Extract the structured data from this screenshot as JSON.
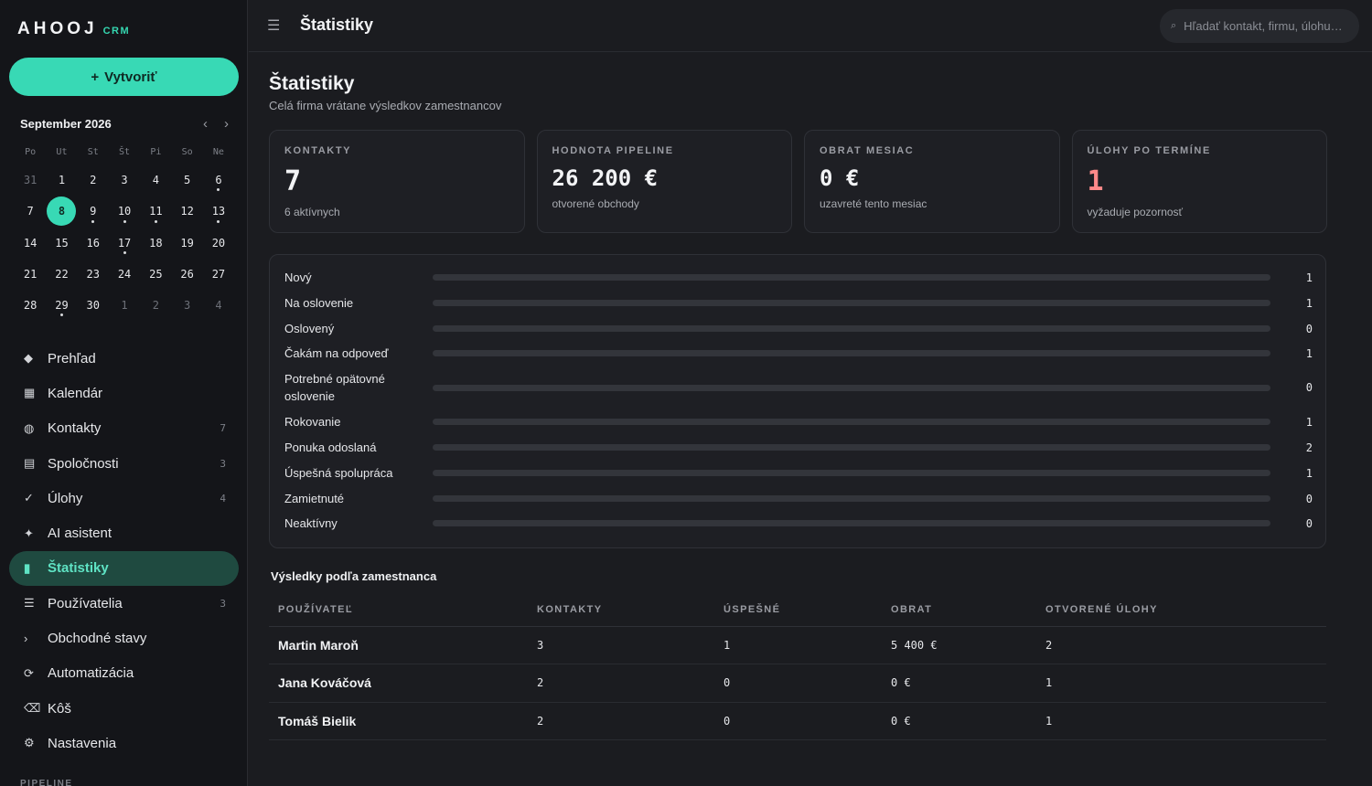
{
  "app": {
    "logo": "AHOOJ",
    "logo_tag": "CRM",
    "create_label": "Vytvoriť",
    "create_icon": "+"
  },
  "calendar": {
    "month_label": "September 2026",
    "prev": "‹",
    "next": "›",
    "weekdays": [
      "Po",
      "Ut",
      "St",
      "Št",
      "Pi",
      "So",
      "Ne"
    ],
    "days": [
      {
        "n": "31",
        "muted": true
      },
      {
        "n": "1"
      },
      {
        "n": "2"
      },
      {
        "n": "3"
      },
      {
        "n": "4"
      },
      {
        "n": "5"
      },
      {
        "n": "6",
        "dot": true
      },
      {
        "n": "7"
      },
      {
        "n": "8",
        "today": true
      },
      {
        "n": "9",
        "dot": true
      },
      {
        "n": "10",
        "dot": true
      },
      {
        "n": "11",
        "dot": true
      },
      {
        "n": "12"
      },
      {
        "n": "13",
        "dot": true
      },
      {
        "n": "14"
      },
      {
        "n": "15"
      },
      {
        "n": "16"
      },
      {
        "n": "17",
        "dot": true
      },
      {
        "n": "18"
      },
      {
        "n": "19"
      },
      {
        "n": "20"
      },
      {
        "n": "21"
      },
      {
        "n": "22"
      },
      {
        "n": "23"
      },
      {
        "n": "24"
      },
      {
        "n": "25"
      },
      {
        "n": "26"
      },
      {
        "n": "27"
      },
      {
        "n": "28"
      },
      {
        "n": "29",
        "dot": true
      },
      {
        "n": "30"
      },
      {
        "n": "1",
        "muted": true
      },
      {
        "n": "2",
        "muted": true
      },
      {
        "n": "3",
        "muted": true
      },
      {
        "n": "4",
        "muted": true
      }
    ]
  },
  "nav": [
    {
      "label": "Prehľad",
      "icon": "◆",
      "icon_name": "diamond-icon",
      "count": ""
    },
    {
      "label": "Kalendár",
      "icon": "▦",
      "icon_name": "calendar-icon",
      "count": ""
    },
    {
      "label": "Kontakty",
      "icon": "◍",
      "icon_name": "contacts-icon",
      "count": "7"
    },
    {
      "label": "Spoločnosti",
      "icon": "▤",
      "icon_name": "building-icon",
      "count": "3"
    },
    {
      "label": "Úlohy",
      "icon": "✓",
      "icon_name": "check-icon",
      "count": "4"
    },
    {
      "label": "AI asistent",
      "icon": "✦",
      "icon_name": "sparkle-icon",
      "count": ""
    },
    {
      "label": "Štatistiky",
      "icon": "▮",
      "icon_name": "stats-icon",
      "count": "",
      "active": true
    },
    {
      "label": "Používatelia",
      "icon": "☰",
      "icon_name": "users-icon",
      "count": "3"
    },
    {
      "label": "Obchodné stavy",
      "icon": "›",
      "icon_name": "chevron-right-icon",
      "count": ""
    },
    {
      "label": "Automatizácia",
      "icon": "⟳",
      "icon_name": "automation-icon",
      "count": ""
    },
    {
      "label": "Kôš",
      "icon": "⌫",
      "icon_name": "trash-icon",
      "count": ""
    },
    {
      "label": "Nastavenia",
      "icon": "⚙",
      "icon_name": "gear-icon",
      "count": ""
    }
  ],
  "nav_section": "PIPELINE",
  "topbar": {
    "menu_icon": "☰",
    "title": "Štatistiky",
    "search_icon": "⌕",
    "search_placeholder": "Hľadať kontakt, firmu, úlohu…"
  },
  "page": {
    "title": "Štatistiky",
    "subtitle": "Celá firma vrátane výsledkov zamestnancov"
  },
  "cards": [
    {
      "label": "KONTAKTY",
      "value": "7",
      "note": "6 aktívnych"
    },
    {
      "label": "HODNOTA PIPELINE",
      "value": "26 200 €",
      "note": "otvorené obchody"
    },
    {
      "label": "OBRAT MESIAC",
      "value": "0 €",
      "note": "uzavreté tento mesiac"
    },
    {
      "label": "ÚLOHY PO TERMÍNE",
      "value": "1",
      "note": "vyžaduje pozornosť",
      "alert": true
    }
  ],
  "pipeline": [
    {
      "name": "Nový",
      "count": "1"
    },
    {
      "name": "Na oslovenie",
      "count": "1"
    },
    {
      "name": "Oslovený",
      "count": "0"
    },
    {
      "name": "Čakám na odpoveď",
      "count": "1"
    },
    {
      "name": "Potrebné opätovné oslovenie",
      "count": "0"
    },
    {
      "name": "Rokovanie",
      "count": "1"
    },
    {
      "name": "Ponuka odoslaná",
      "count": "2"
    },
    {
      "name": "Úspešná spolupráca",
      "count": "1"
    },
    {
      "name": "Zamietnuté",
      "count": "0"
    },
    {
      "name": "Neaktívny",
      "count": "0"
    }
  ],
  "results": {
    "title": "Výsledky podľa zamestnanca",
    "columns": [
      "POUŽÍVATEĽ",
      "KONTAKTY",
      "ÚSPEŠNÉ",
      "OBRAT",
      "OTVORENÉ ÚLOHY"
    ],
    "rows": [
      [
        "Martin Maroň",
        "3",
        "1",
        "5 400 €",
        "2"
      ],
      [
        "Jana Kováčová",
        "2",
        "0",
        "0 €",
        "1"
      ],
      [
        "Tomáš Bielik",
        "2",
        "0",
        "0 €",
        "1"
      ]
    ]
  },
  "colors": {
    "accent": "#38d9b5",
    "active_bg": "#1f4a40",
    "alert": "#ff8a8a",
    "background": "#1b1c20",
    "sidebar": "#141519"
  }
}
